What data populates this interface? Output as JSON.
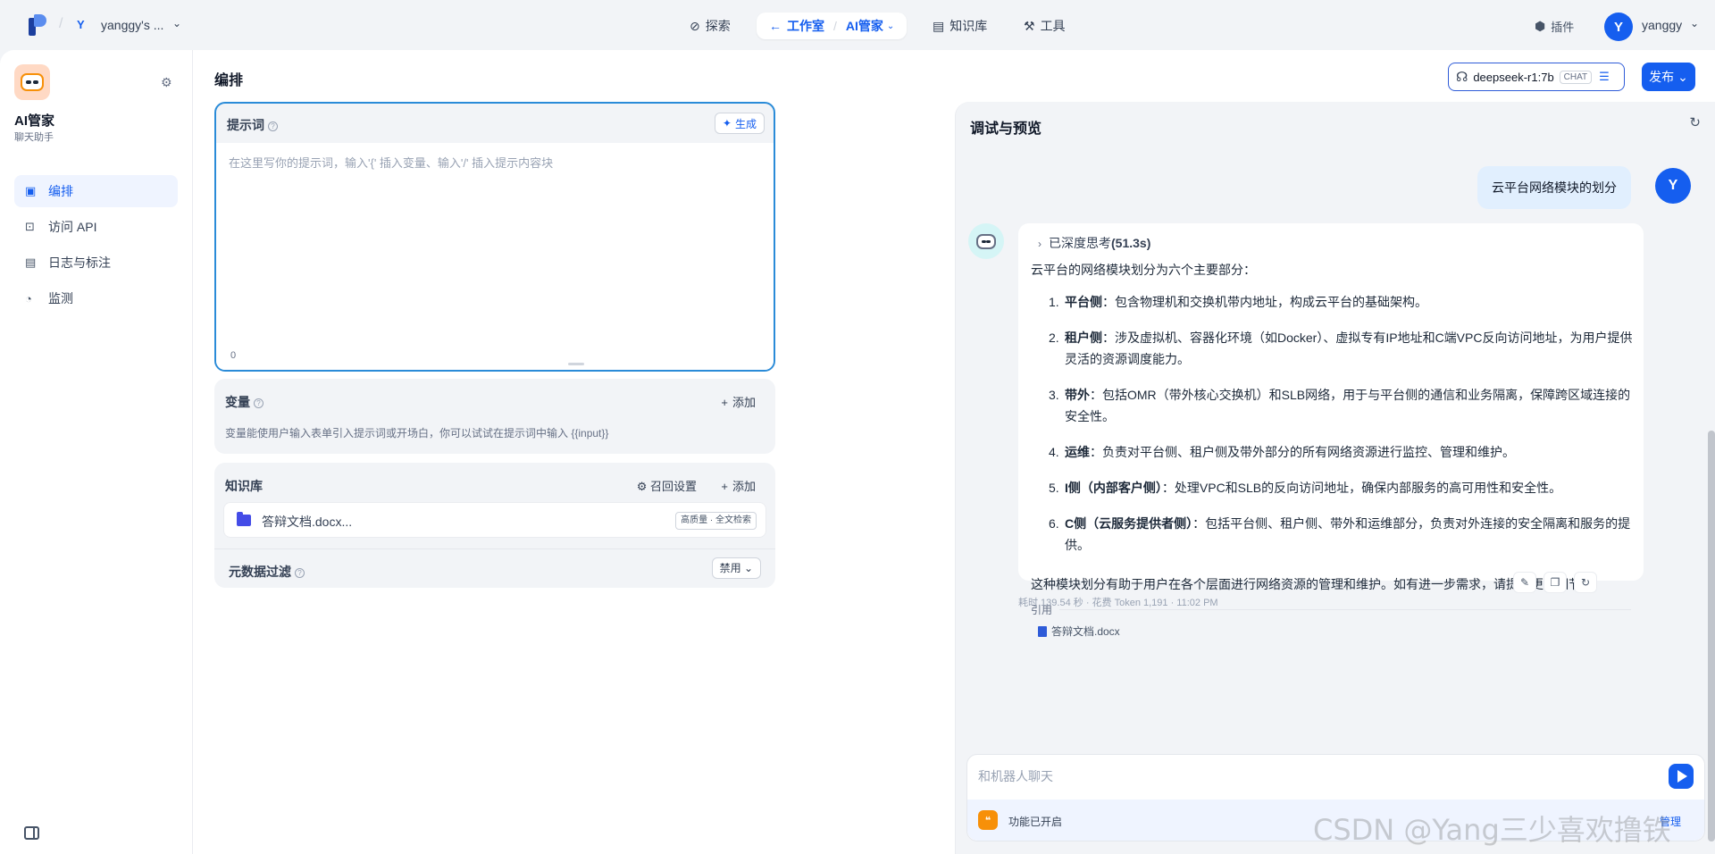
{
  "topbar": {
    "workspace_avatar": "Y",
    "workspace_name": "yanggy's ...",
    "nav_explore": "探索",
    "nav_studio": "工作室",
    "nav_app": "AI管家",
    "nav_knowledge": "知识库",
    "nav_tools": "工具",
    "plugin": "插件",
    "user_avatar": "Y",
    "user_name": "yanggy"
  },
  "sidebar": {
    "app_name": "AI管家",
    "app_type": "聊天助手",
    "items": [
      {
        "label": "编排",
        "icon": "layout-icon",
        "active": true
      },
      {
        "label": "访问 API",
        "icon": "terminal-icon",
        "active": false
      },
      {
        "label": "日志与标注",
        "icon": "log-icon",
        "active": false
      },
      {
        "label": "监测",
        "icon": "monitor-icon",
        "active": false
      }
    ]
  },
  "header": {
    "title": "编排",
    "model_name": "deepseek-r1:7b",
    "model_mode": "CHAT",
    "publish_label": "发布"
  },
  "prompt": {
    "label": "提示词",
    "generate_label": "生成",
    "placeholder": "在这里写你的提示词，输入'{' 插入变量、输入'/' 插入提示内容块",
    "count": "0"
  },
  "variables": {
    "label": "变量",
    "add_label": "添加",
    "description": "变量能使用户输入表单引入提示词或开场白，你可以试试在提示词中输入 {{input}}"
  },
  "knowledge": {
    "label": "知识库",
    "recall_label": "召回设置",
    "add_label": "添加",
    "item_name": "答辩文档.docx...",
    "item_tag": "高质量 · 全文检索",
    "meta_filter_label": "元数据过滤",
    "meta_filter_value": "禁用"
  },
  "debug": {
    "title": "调试与预览",
    "user_avatar": "Y",
    "user_message": "云平台网络模块的划分",
    "think_label": "已深度思考",
    "think_time": "(51.3s)",
    "intro": "云平台的网络模块划分为六个主要部分：",
    "items": [
      {
        "num": "1.",
        "head": "平台侧",
        "sep": "：",
        "text": "包含物理机和交换机带内地址，构成云平台的基础架构。"
      },
      {
        "num": "2.",
        "head": "租户侧",
        "sep": "：",
        "text": "涉及虚拟机、容器化环境（如Docker）、虚拟专有IP地址和C端VPC反向访问地址，为用户提供灵活的资源调度能力。"
      },
      {
        "num": "3.",
        "head": "带外",
        "sep": "：",
        "text": "包括OMR（带外核心交换机）和SLB网络，用于与平台侧的通信和业务隔离，保障跨区域连接的安全性。"
      },
      {
        "num": "4.",
        "head": "运维",
        "sep": "：",
        "text": "负责对平台侧、租户侧及带外部分的所有网络资源进行监控、管理和维护。"
      },
      {
        "num": "5.",
        "head": "I侧（内部客户侧）",
        "sep": "：",
        "text": "处理VPC和SLB的反向访问地址，确保内部服务的高可用性和安全性。"
      },
      {
        "num": "6.",
        "head": "C侧（云服务提供者侧）",
        "sep": "：",
        "text": "包括平台侧、租户侧、带外和运维部分，负责对外连接的安全隔离和服务的提供。"
      }
    ],
    "outro": "这种模块划分有助于用户在各个层面进行网络资源的管理和维护。如有进一步需求，请提供更多细节。",
    "citation_label": "引用",
    "citation_file": "答辩文档.docx",
    "meta": "耗时 139.54 秒 · 花费 Token 1,191 · 11:02 PM",
    "input_placeholder": "和机器人聊天",
    "feature_text": "功能已开启",
    "manage_label": "管理"
  },
  "watermark": "CSDN @Yang三少喜欢撸铁"
}
